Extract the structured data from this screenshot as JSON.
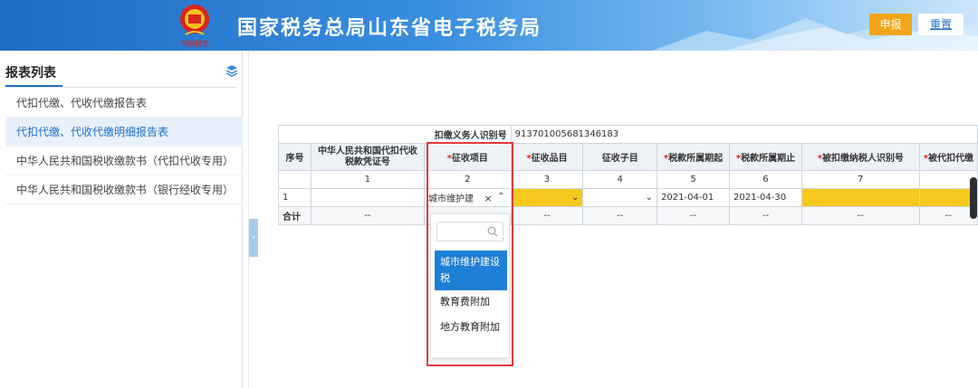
{
  "header": {
    "title": "国家税务总局山东省电子税务局",
    "emblem_caption": "中国税务",
    "declare_label": "申报",
    "reset_label": "重置"
  },
  "sidebar": {
    "title": "报表列表",
    "items": [
      {
        "label": "代扣代缴、代收代缴报告表",
        "active": false
      },
      {
        "label": "代扣代缴、代收代缴明细报告表",
        "active": true
      },
      {
        "label": "中华人民共和国税收缴款书（代扣代收专用）",
        "active": false
      },
      {
        "label": "中华人民共和国税收缴款书（银行经收专用）",
        "active": false
      }
    ]
  },
  "form": {
    "withholder_id_label": "扣缴义务人识别号",
    "withholder_id_value": "913701005681346183",
    "columns": [
      {
        "label": "序号",
        "required": false,
        "index": ""
      },
      {
        "label": "中华人民共和国代扣代收税款凭证号",
        "required": false,
        "index": "1"
      },
      {
        "label": "征收项目",
        "required": true,
        "index": "2"
      },
      {
        "label": "征收品目",
        "required": true,
        "index": "3"
      },
      {
        "label": "征收子目",
        "required": false,
        "index": "4"
      },
      {
        "label": "税款所属期起",
        "required": true,
        "index": "5"
      },
      {
        "label": "税款所属期止",
        "required": true,
        "index": "6"
      },
      {
        "label": "被扣缴纳税人识别号",
        "required": true,
        "index": "7"
      },
      {
        "label": "被代扣代缴",
        "required": true,
        "index": ""
      }
    ],
    "row": {
      "seq": "1",
      "tax_item_value": "城市维护建",
      "period_start": "2021-04-01",
      "period_end": "2021-04-30"
    },
    "total_label": "合计",
    "empty_cell": "--"
  },
  "dropdown": {
    "options": [
      "城市维护建设税",
      "教育费附加",
      "地方教育附加"
    ],
    "selected_index": 0
  },
  "colors": {
    "brand": "#1f6fc7",
    "accent": "#f2a51a",
    "highlight": "#f7c81e",
    "annotation": "#e23b3b"
  }
}
